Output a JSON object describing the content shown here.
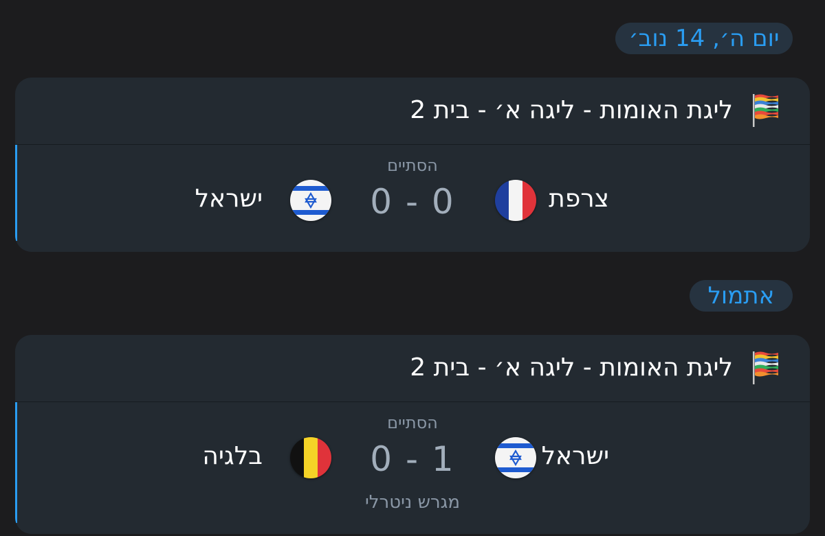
{
  "sections": [
    {
      "date_label": "יום ה׳, 14 נוב׳",
      "league": {
        "title": "ליגת האומות - ליגה א׳ - בית 2",
        "icon": "nations-league-flag-icon"
      },
      "match": {
        "status": "הסתיים",
        "home_team": "צרפת",
        "home_flag": "france-flag-icon",
        "away_team": "ישראל",
        "away_flag": "israel-flag-icon",
        "score": "0 - 0"
      }
    },
    {
      "date_label": "אתמול",
      "league": {
        "title": "ליגת האומות - ליגה א׳ - בית 2",
        "icon": "nations-league-flag-icon"
      },
      "match": {
        "status": "הסתיים",
        "home_team": "ישראל",
        "home_flag": "israel-flag-icon",
        "away_team": "בלגיה",
        "away_flag": "belgium-flag-icon",
        "score": "0 - 1",
        "venue": "מגרש ניטרלי"
      }
    }
  ],
  "colors": {
    "background": "#1c1c1e",
    "card": "#232a31",
    "accent": "#2a9df2",
    "muted_text": "#8a97a6"
  }
}
